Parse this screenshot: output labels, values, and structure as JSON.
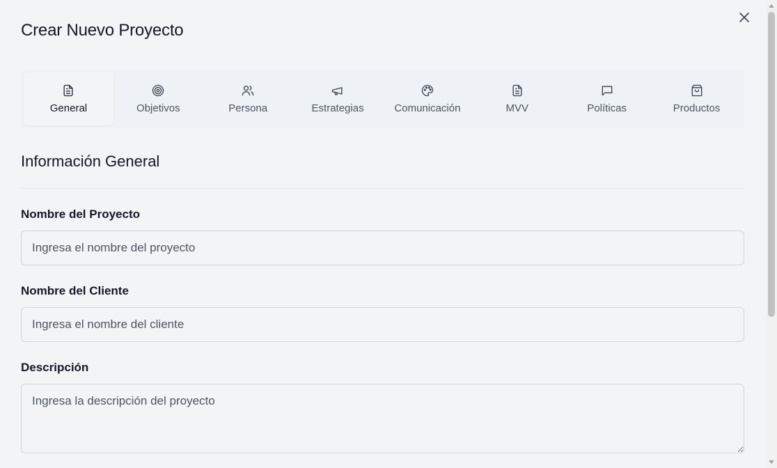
{
  "dialog": {
    "title": "Crear Nuevo Proyecto"
  },
  "tabs": [
    {
      "label": "General",
      "icon": "document-icon",
      "active": true
    },
    {
      "label": "Objetivos",
      "icon": "target-icon",
      "active": false
    },
    {
      "label": "Persona",
      "icon": "users-icon",
      "active": false
    },
    {
      "label": "Estrategias",
      "icon": "megaphone-icon",
      "active": false
    },
    {
      "label": "Comunicación",
      "icon": "palette-icon",
      "active": false
    },
    {
      "label": "MVV",
      "icon": "document-icon",
      "active": false
    },
    {
      "label": "Políticas",
      "icon": "message-icon",
      "active": false
    },
    {
      "label": "Productos",
      "icon": "shopping-bag-icon",
      "active": false
    }
  ],
  "section": {
    "title": "Información General"
  },
  "form": {
    "project_name": {
      "label": "Nombre del Proyecto",
      "value": "",
      "placeholder": "Ingresa el nombre del proyecto"
    },
    "client_name": {
      "label": "Nombre del Cliente",
      "value": "",
      "placeholder": "Ingresa el nombre del cliente"
    },
    "description": {
      "label": "Descripción",
      "value": "",
      "placeholder": "Ingresa la descripción del proyecto"
    }
  },
  "colors": {
    "background": "#f3f4f6",
    "text": "#111827",
    "muted": "#4b5563",
    "border": "#d1d5db"
  }
}
